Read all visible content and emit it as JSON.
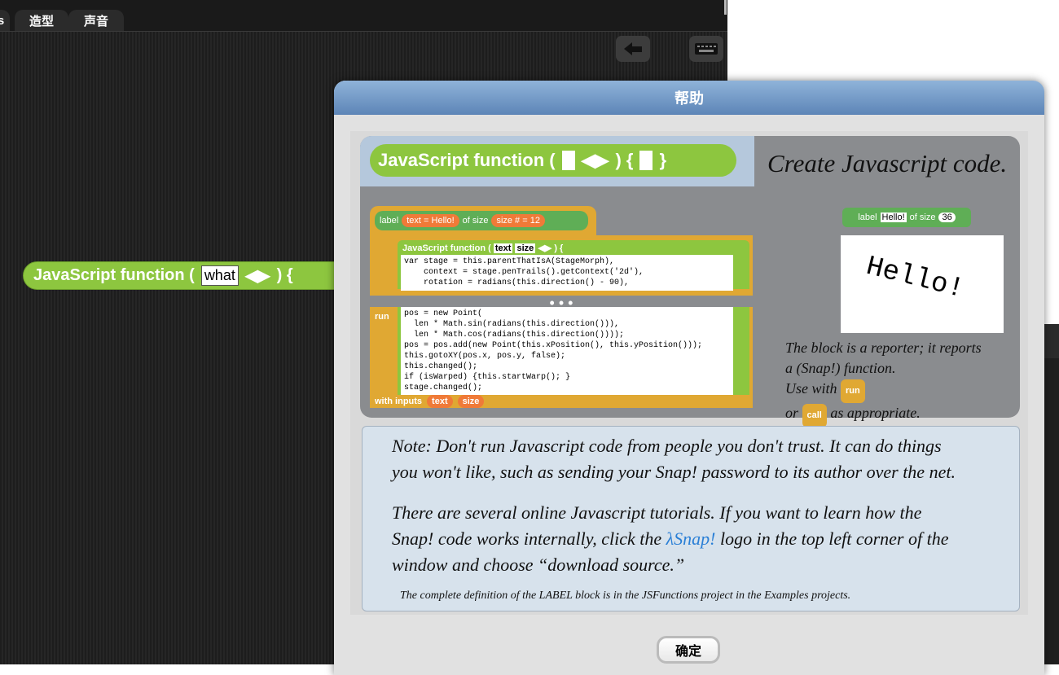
{
  "tabs": [
    "造型",
    "声音"
  ],
  "tab_partial": "s",
  "editor": {
    "js_block": {
      "label": "JavaScript function (",
      "slot": "what",
      "arrows": "◀▶",
      "close": ") {"
    }
  },
  "dialog": {
    "title": "帮助",
    "ok_label": "确定",
    "help": {
      "head_block": {
        "label": "JavaScript function (",
        "arrows": "◀▶",
        "close": ") {",
        "end": "}"
      },
      "create_title": "Create Javascript code.",
      "label_block": {
        "label": "label",
        "text_pill": "text = Hello!",
        "of_size": "of size",
        "size_pill": "size # = 12"
      },
      "inner_js": {
        "label": "JavaScript function (",
        "text": "text",
        "size": "size",
        "close": "◀▶ ) {"
      },
      "code1": "var stage = this.parentThatIsA(StageMorph),\n    context = stage.penTrails().getContext('2d'),\n    rotation = radians(this.direction() - 90),",
      "dots": "• • •",
      "run": "run",
      "code2": "pos = new Point(\n  len * Math.sin(radians(this.direction())),\n  len * Math.cos(radians(this.direction())));\npos = pos.add(new Point(this.xPosition(), this.yPosition()));\nthis.gotoXY(pos.x, pos.y, false);\nthis.changed();\nif (isWarped) {this.startWarp(); }\nstage.changed();",
      "with_inputs": "with inputs",
      "text_pill": "text",
      "size_pill": "size",
      "mini_label": {
        "label": "label",
        "text": "Hello!",
        "of_size": "of size",
        "size": "36"
      },
      "hello": "Hello!",
      "reporter_note_1": "The block is a reporter; it reports",
      "reporter_note_2": "a (Snap!) function.",
      "reporter_note_3": "Use with",
      "reporter_run": "run",
      "reporter_note_4": "or",
      "reporter_call": "call",
      "reporter_note_5": "as appropriate.",
      "note1_line1": "Note:  Don't run Javascript code from people you don't trust.  It can do things",
      "note1_line2": "you won't like, such as sending your Snap! password to its author over the net.",
      "note2_line1": "There are several online Javascript tutorials.  If you want to learn how the",
      "note2_line2a": "Snap! code works internally, click the",
      "snap_logo": "λSnap!",
      "note2_line2b": "logo in the top left corner of  the",
      "note2_line3": "window and choose “download source.”",
      "note3": "The complete definition of  the LABEL block is in the JSFunctions project in the Examples projects."
    }
  }
}
